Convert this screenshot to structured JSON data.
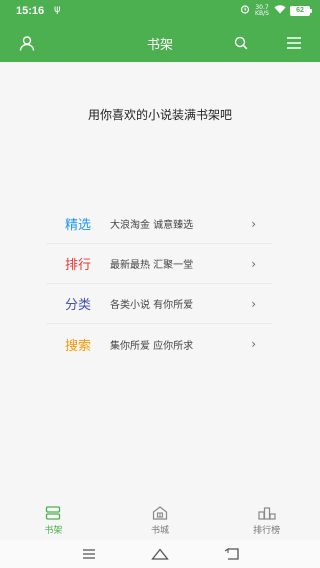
{
  "status_bar": {
    "time": "15:16",
    "usb_symbol": "ψ",
    "speed_value": "30.7",
    "speed_unit": "KB/S",
    "battery": "62"
  },
  "header": {
    "title": "书架",
    "icons": [
      "user-icon",
      "search-icon",
      "menu-icon"
    ]
  },
  "main": {
    "prompt": "用你喜欢的小说装满书架吧",
    "items": [
      {
        "label": "精选",
        "desc": "大浪淘金  诚意臻选",
        "color": "#2196f3",
        "chevron": "›"
      },
      {
        "label": "排行",
        "desc": "最新最热  汇聚一堂",
        "color": "#e53935",
        "chevron": "›"
      },
      {
        "label": "分类",
        "desc": "各类小说  有你所爱",
        "color": "#3f51b5",
        "chevron": "›"
      },
      {
        "label": "搜索",
        "desc": "集你所爱  应你所求",
        "color": "#ff9800",
        "chevron": "›"
      }
    ]
  },
  "tabs": [
    {
      "label": "书架",
      "icon": "bookshelf-icon",
      "active": true
    },
    {
      "label": "书城",
      "icon": "bookstore-icon",
      "active": false
    },
    {
      "label": "排行榜",
      "icon": "ranking-icon",
      "active": false
    }
  ],
  "colors": {
    "accent": "#4caf50",
    "background": "#f6f6f6"
  }
}
